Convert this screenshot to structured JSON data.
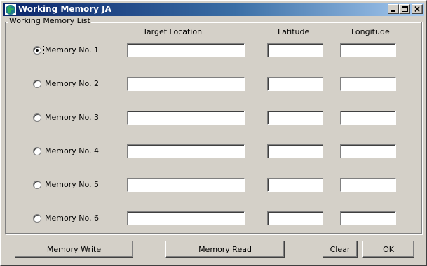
{
  "window": {
    "title": "Working Memory JA",
    "icon": "app-globe-icon",
    "controls": [
      "minimize-icon",
      "maximize-icon",
      "close-icon"
    ]
  },
  "group": {
    "title": "Working Memory List"
  },
  "columns": {
    "target": "Target Location",
    "latitude": "Latitude",
    "longitude": "Longitude"
  },
  "memories": [
    {
      "label": "Memory No. 1",
      "selected": true,
      "target": "",
      "latitude": "",
      "longitude": ""
    },
    {
      "label": "Memory No. 2",
      "selected": false,
      "target": "",
      "latitude": "",
      "longitude": ""
    },
    {
      "label": "Memory No. 3",
      "selected": false,
      "target": "",
      "latitude": "",
      "longitude": ""
    },
    {
      "label": "Memory No. 4",
      "selected": false,
      "target": "",
      "latitude": "",
      "longitude": ""
    },
    {
      "label": "Memory No. 5",
      "selected": false,
      "target": "",
      "latitude": "",
      "longitude": ""
    },
    {
      "label": "Memory No. 6",
      "selected": false,
      "target": "",
      "latitude": "",
      "longitude": ""
    }
  ],
  "buttons": {
    "write": "Memory Write",
    "read": "Memory Read",
    "clear": "Clear",
    "ok": "OK"
  }
}
